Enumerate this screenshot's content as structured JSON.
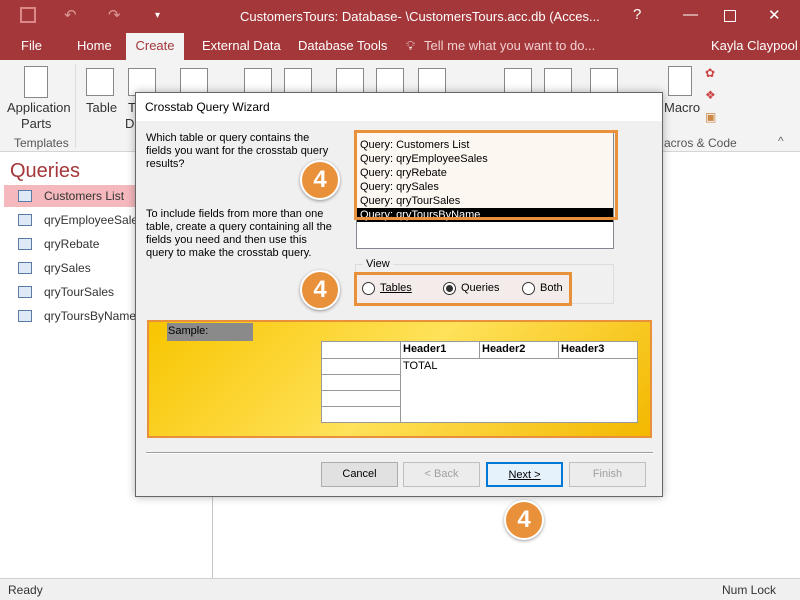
{
  "window": {
    "title": "CustomersTours: Database- \\CustomersTours.acc.db (Acces...",
    "help": "?",
    "user": "Kayla Claypool"
  },
  "tabs": [
    "File",
    "Home",
    "Create",
    "External Data",
    "Database Tools"
  ],
  "tell_me": "Tell me what you want to do...",
  "ribbon": {
    "app_parts": "Application",
    "app_parts2": "Parts",
    "templates": "Templates",
    "table": "Table",
    "t2": "T",
    "t3": "De",
    "macro": "Macro",
    "macros_code": "acros & Code"
  },
  "nav": {
    "title": "Queries",
    "items": [
      "Customers List",
      "qryEmployeeSales",
      "qryRebate",
      "qrySales",
      "qryTourSales",
      "qryToursByName"
    ]
  },
  "status": {
    "left": "Ready",
    "right": "Num Lock"
  },
  "dialog": {
    "title": "Crosstab Query Wizard",
    "prompt1": "Which table or query contains the fields you want for the crosstab query results?",
    "prompt2": "To include fields from more than one table, create a query containing all the fields you need and then use this query to make the crosstab query.",
    "list": [
      "Query: Customers List",
      "Query: qryEmployeeSales",
      "Query: qryRebate",
      "Query: qrySales",
      "Query: qryTourSales",
      "Query: qryToursByName"
    ],
    "selected": "Query: qryToursByName",
    "view_label": "View",
    "view_options": [
      "Tables",
      "Queries",
      "Both"
    ],
    "view_selected": "Queries",
    "sample_label": "Sample:",
    "headers": [
      "Header1",
      "Header2",
      "Header3"
    ],
    "total": "TOTAL",
    "buttons": {
      "cancel": "Cancel",
      "back": "< Back",
      "next": "Next >",
      "finish": "Finish"
    }
  },
  "callouts": [
    "4",
    "4",
    "4"
  ],
  "colors": {
    "accent": "#a4373a",
    "highlight": "#e8913a"
  }
}
